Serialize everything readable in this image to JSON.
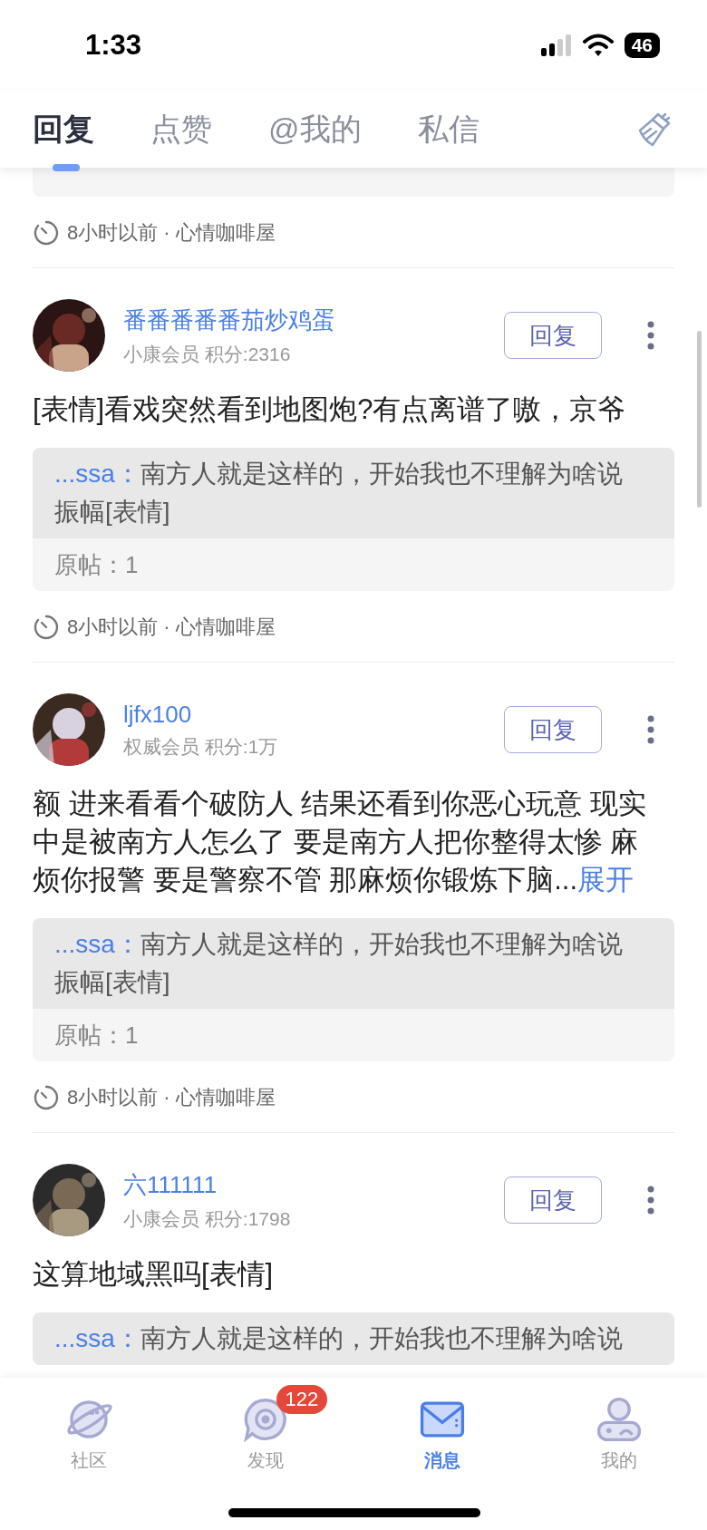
{
  "status_bar": {
    "time": "1:33",
    "battery": "46"
  },
  "tabs": [
    {
      "label": "回复",
      "selected": true
    },
    {
      "label": "点赞",
      "selected": false
    },
    {
      "label": "@我的",
      "selected": false
    },
    {
      "label": "私信",
      "selected": false
    }
  ],
  "top_partial": {
    "footer": "8小时以前 · 心情咖啡屋"
  },
  "replies": [
    {
      "name": "番番番番番茄炒鸡蛋",
      "member": "小康会员 积分:2316",
      "reply_button": "回复",
      "content": "[表情]看戏突然看到地图炮?有点离谱了嗷，京爷",
      "quote": {
        "author": "...ssa：",
        "text": "南方人就是这样的，开始我也不理解为啥说振幅[表情]",
        "origin": "原帖：1"
      },
      "footer": "8小时以前 · 心情咖啡屋"
    },
    {
      "name": "ljfx100",
      "member": "权威会员 积分:1万",
      "reply_button": "回复",
      "content": "额 进来看看个破防人 结果还看到你恶心玩意 现实中是被南方人怎么了 要是南方人把你整得太惨 麻烦你报警 要是警察不管 那麻烦你锻炼下脑...",
      "expand": "展开",
      "quote": {
        "author": "...ssa：",
        "text": "南方人就是这样的，开始我也不理解为啥说振幅[表情]",
        "origin": "原帖：1"
      },
      "footer": "8小时以前 · 心情咖啡屋"
    },
    {
      "name": "六111111",
      "member": "小康会员 积分:1798",
      "reply_button": "回复",
      "content": "这算地域黑吗[表情]",
      "quote": {
        "author": "...ssa：",
        "text": "南方人就是这样的，开始我也不理解为啥说"
      }
    }
  ],
  "nav": [
    {
      "label": "社区",
      "selected": false
    },
    {
      "label": "发现",
      "selected": false,
      "badge": "122"
    },
    {
      "label": "消息",
      "selected": true
    },
    {
      "label": "我的",
      "selected": false
    }
  ]
}
